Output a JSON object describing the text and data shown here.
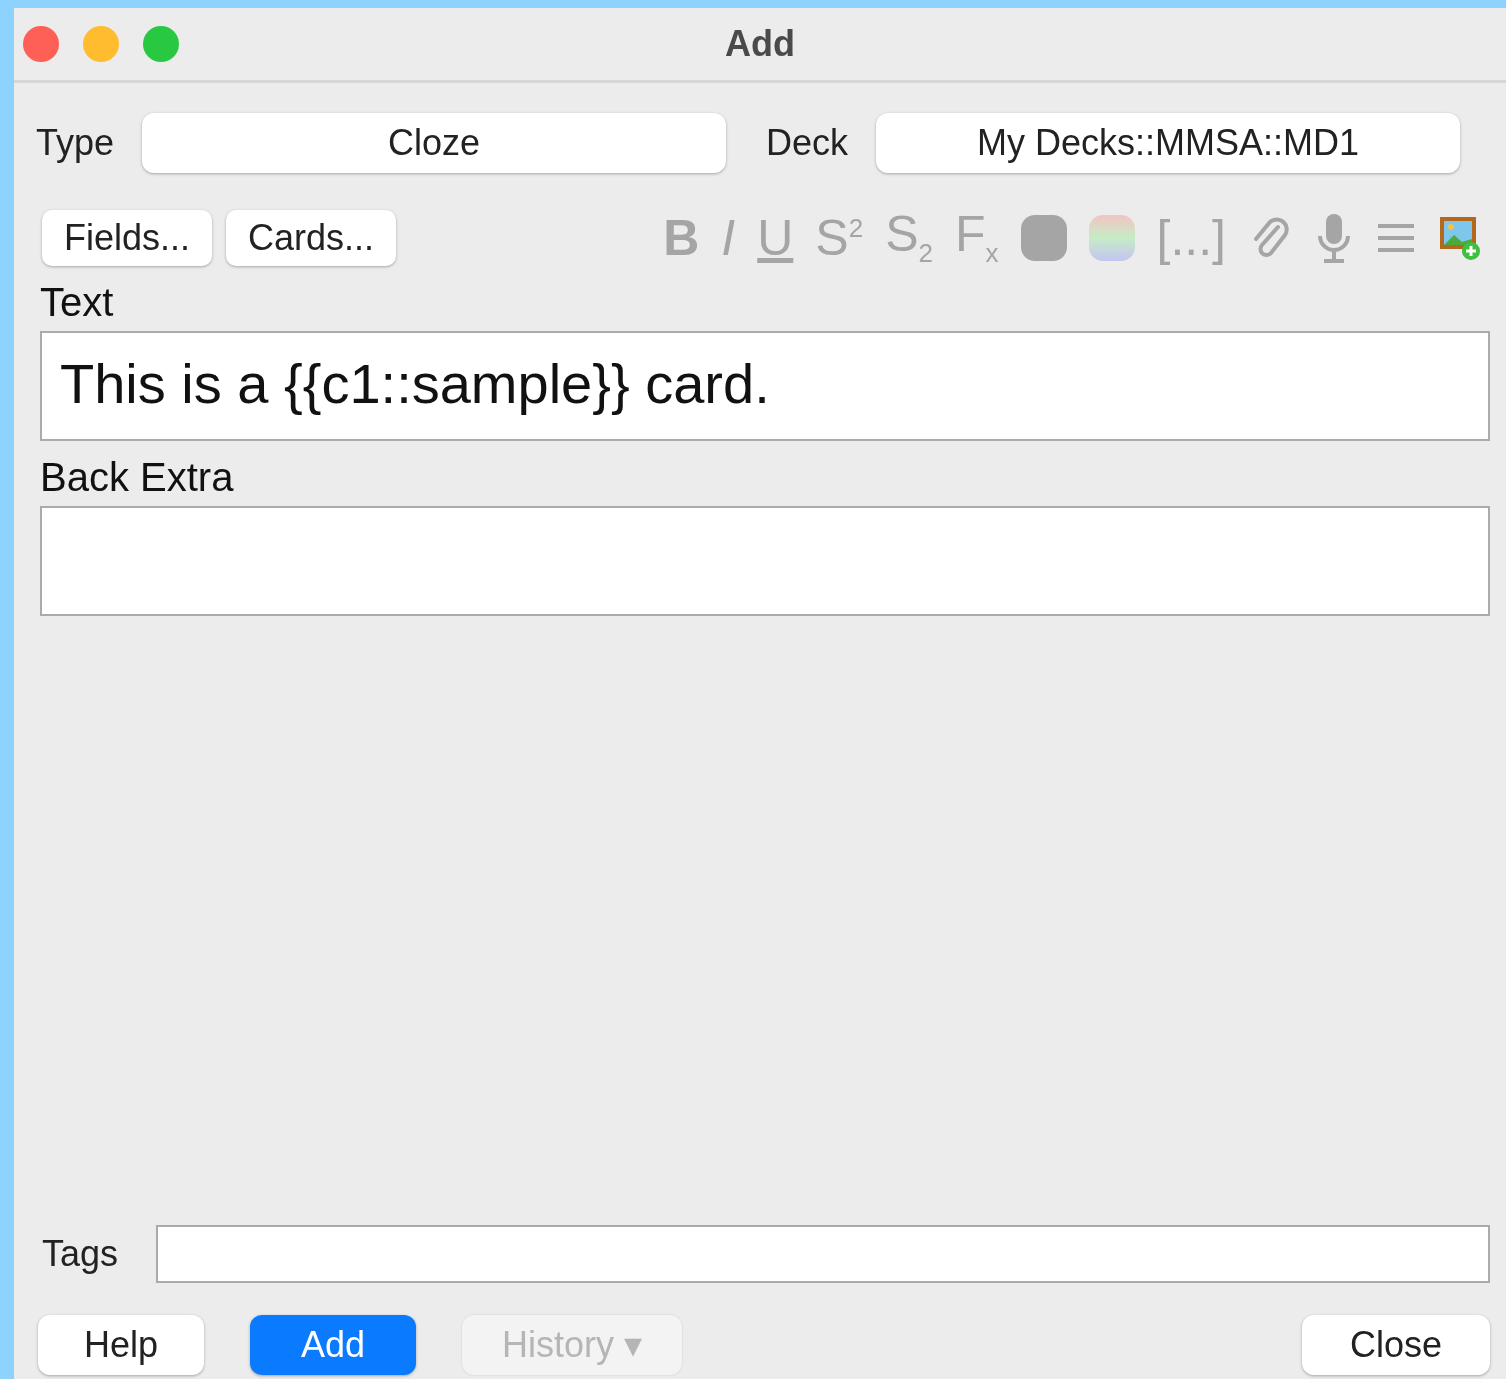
{
  "window": {
    "title": "Add"
  },
  "type": {
    "label": "Type",
    "value": "Cloze"
  },
  "deck": {
    "label": "Deck",
    "value": "My Decks::MMSA::MD1"
  },
  "editor_buttons": [
    {
      "label": "Fields..."
    },
    {
      "label": "Cards..."
    }
  ],
  "toolbar": [
    {
      "kind": "bold",
      "text": "B"
    },
    {
      "kind": "italic",
      "text": "I"
    },
    {
      "kind": "underline",
      "text": "U"
    },
    {
      "kind": "glyph",
      "text": "S$^{2}$"
    },
    {
      "kind": "glyph",
      "text": "S$_{2}$"
    },
    {
      "kind": "glyph",
      "text": "F$_{x}$"
    },
    {
      "kind": "swatch"
    },
    {
      "kind": "gradient"
    },
    {
      "kind": "glyph",
      "text": "[...]"
    },
    {
      "kind": "clip"
    },
    {
      "kind": "mic"
    },
    {
      "kind": "lines"
    },
    {
      "kind": "image"
    }
  ],
  "fields": [
    {
      "label": "Text",
      "value": "This is a {{c1::sample}} card."
    },
    {
      "label": "Back Extra"
    }
  ],
  "tags": {
    "label": "Tags"
  },
  "buttons": [
    {
      "label": "Help",
      "primary": false,
      "disabled": false
    },
    {
      "label": "Add",
      "primary": true,
      "disabled": false
    },
    {
      "label": "History ▾",
      "primary": false,
      "disabled": true
    }
  ],
  "close_button": {
    "label": "Close"
  }
}
